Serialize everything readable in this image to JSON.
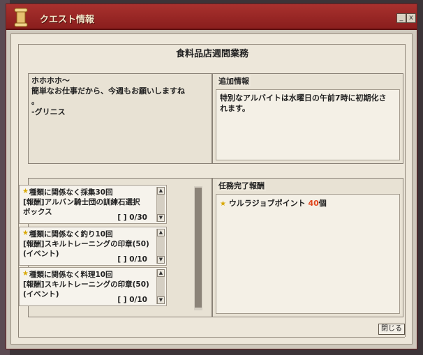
{
  "window": {
    "title": "クエスト情報",
    "minimize_label": "_",
    "close_label": "x"
  },
  "quest": {
    "title": "食料品店週間業務",
    "description": "ホホホホ〜\n簡単なお仕事だから、今週もお願いしますね\n。\n-グリニス",
    "additional_info_label": "追加情報",
    "additional_info": "特別なアルバイトは水曜日の午前7時に初期化さ\nれます。"
  },
  "tasks": [
    {
      "name": "種類に関係なく採集30回",
      "reward": "[報酬]アルバン騎士団の訓練石選択\nボックス",
      "progress": "[   ] 0/30"
    },
    {
      "name": "種類に関係なく釣り10回",
      "reward": "[報酬]スキルトレーニングの印章(50)\n(イベント)",
      "progress": "[   ] 0/10"
    },
    {
      "name": "種類に関係なく料理10回",
      "reward": "[報酬]スキルトレーニングの印章(50)\n(イベント)",
      "progress": "[   ] 0/10"
    }
  ],
  "completion": {
    "label": "任務完了報酬",
    "reward_name": "ウルラジョブポイント",
    "reward_amount": "40",
    "reward_unit": "個"
  },
  "buttons": {
    "close": "閉じる"
  },
  "colors": {
    "title_bar": "#8a1e1d",
    "parchment": "#ede7da",
    "reward_amount": "#e0461d",
    "star": "#d8a800"
  }
}
